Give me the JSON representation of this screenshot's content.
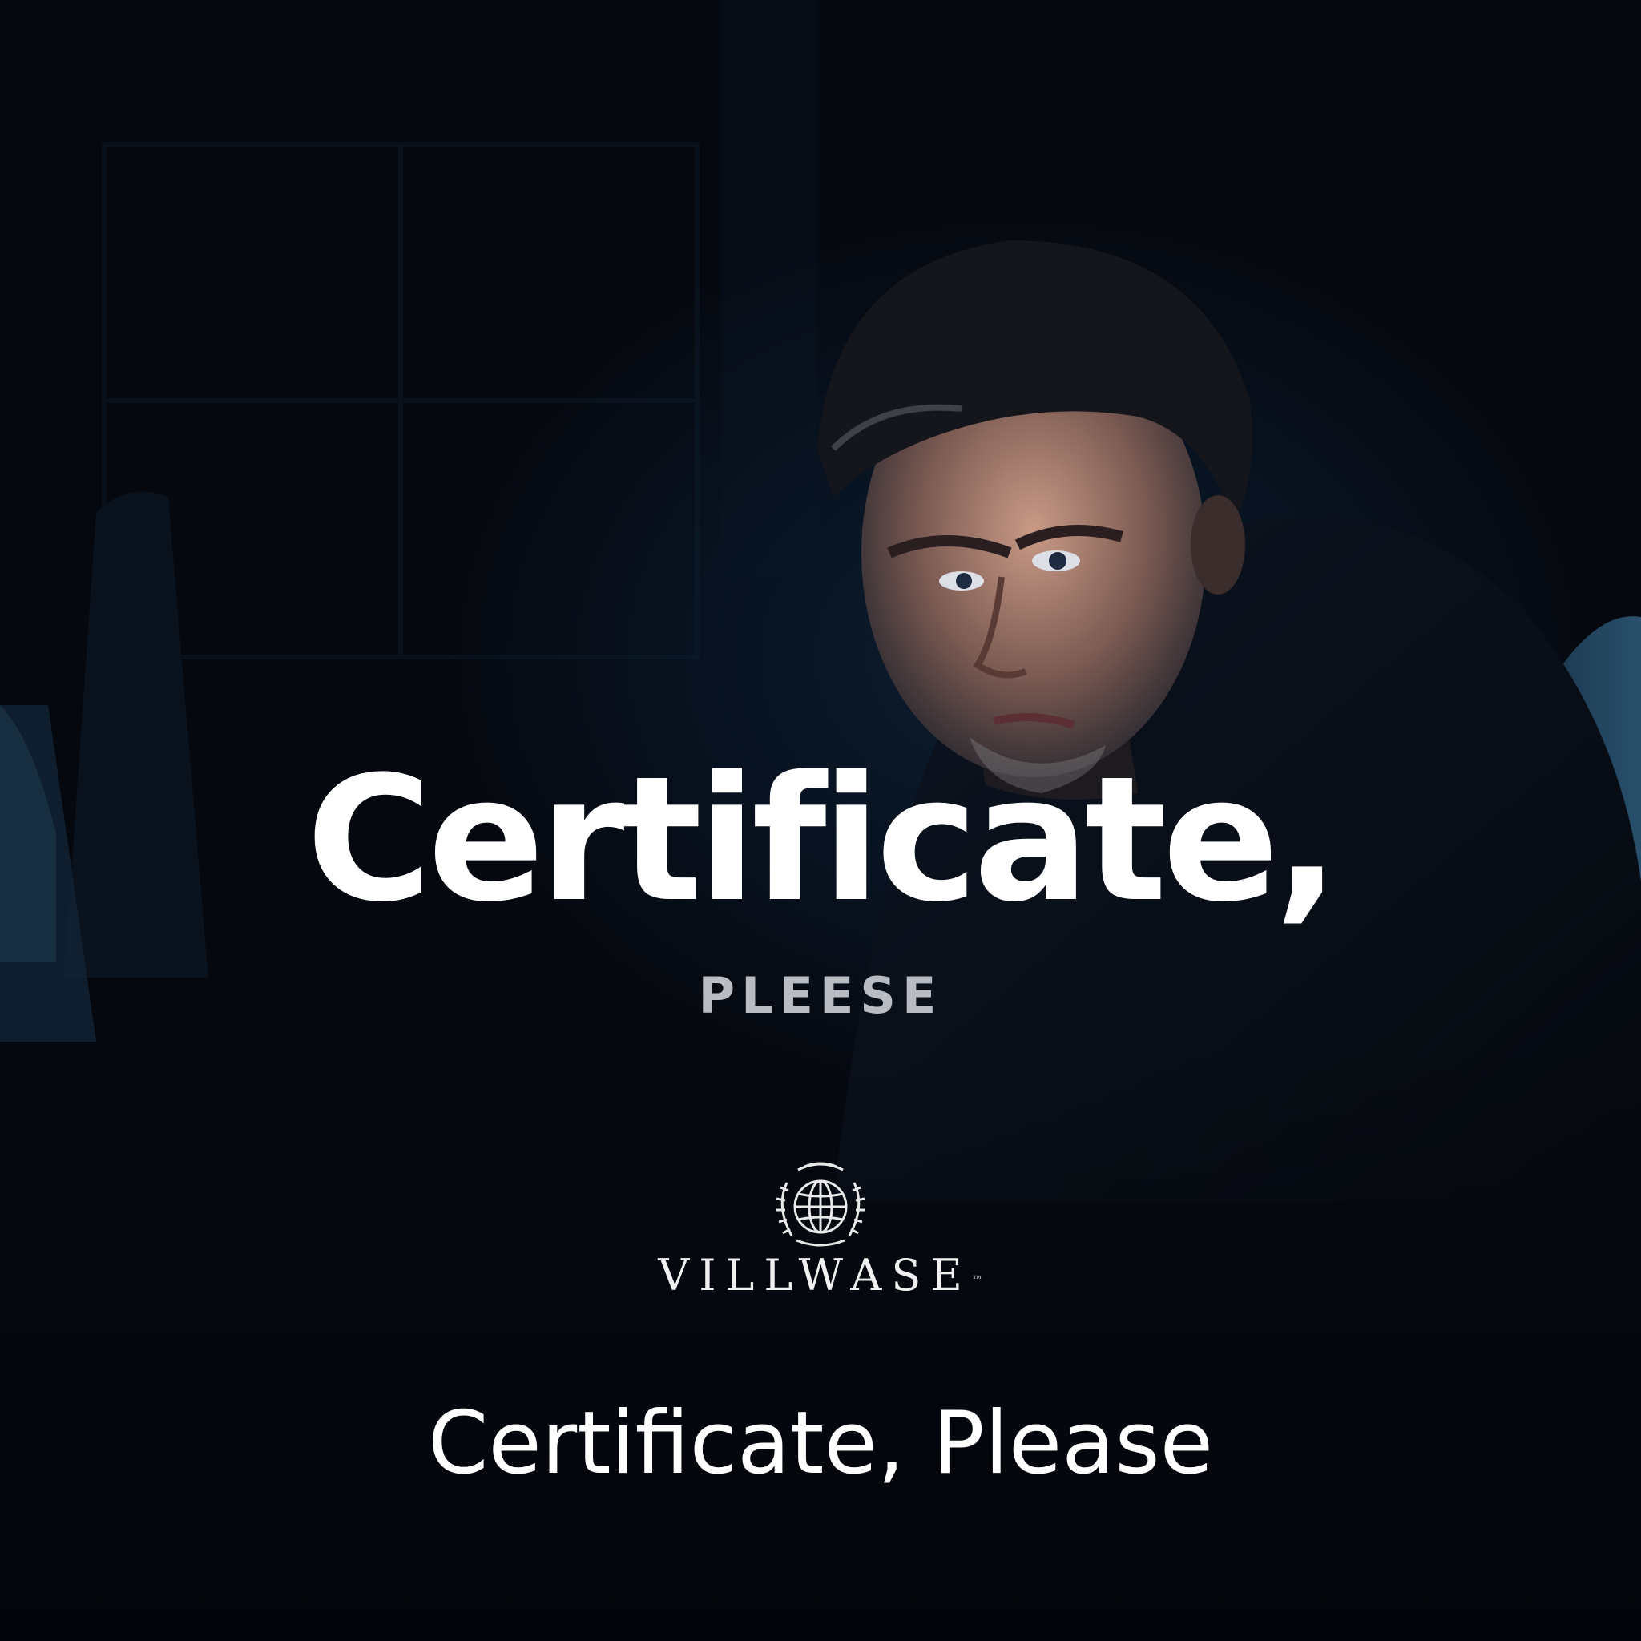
{
  "headline": "Certificate,",
  "subhead": "PLEESE",
  "brand": {
    "name": "VILLWASE",
    "mark": "™",
    "emblem_icon": "globe-laurel-emblem-icon"
  },
  "footer_title": "Certificate, Please",
  "colors": {
    "background": "#05080f",
    "headline": "#ffffff",
    "subhead": "#b9bcc2",
    "brand": "#f0f0f0"
  }
}
